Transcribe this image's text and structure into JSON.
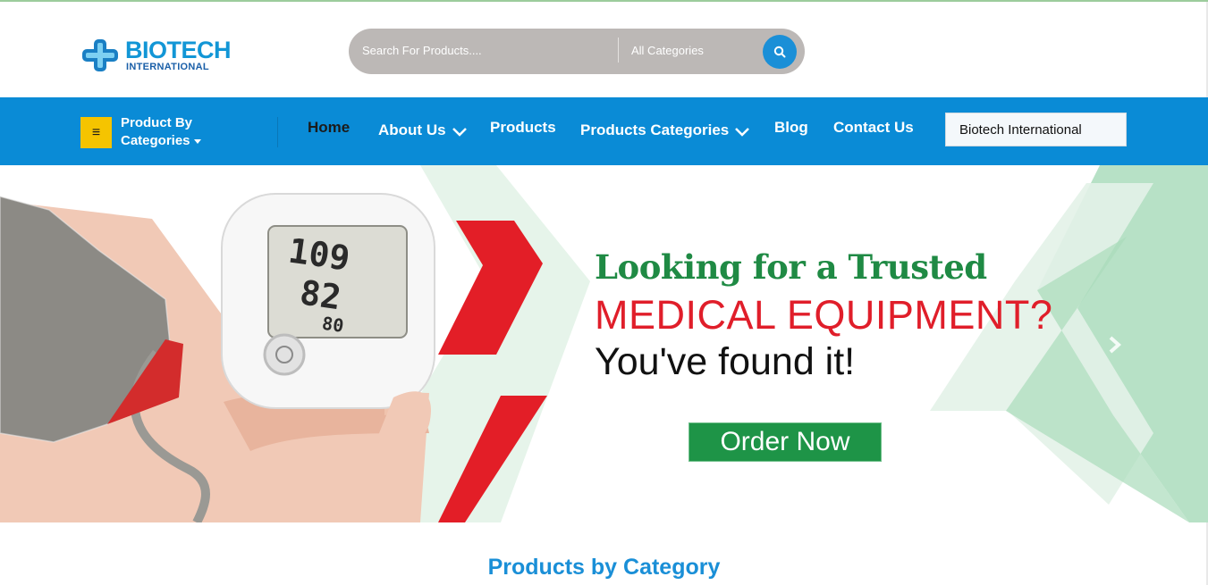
{
  "brand": {
    "name_line1": "BIOTECH",
    "name_line2": "INTERNATIONAL",
    "primary_color": "#1296d6"
  },
  "search": {
    "placeholder": "Search For Products....",
    "category_value": "All Categories",
    "button_icon": "search-icon"
  },
  "nav": {
    "background": "#0a8bd6",
    "category_menu": {
      "label_line1": "Product By",
      "label_line2": "Categories",
      "icon": "hamburger-icon"
    },
    "items": [
      {
        "label": "Home",
        "active": true
      },
      {
        "label": "About Us",
        "dropdown": true
      },
      {
        "label": "Products"
      },
      {
        "label": "Products Categories",
        "dropdown": true
      },
      {
        "label": "Blog"
      },
      {
        "label": "Contact Us"
      }
    ],
    "select_value": "Biotech International"
  },
  "banner": {
    "headline": "Looking for a Trusted",
    "subheadline": "MEDICAL EQUIPMENT?",
    "tagline": "You've found it!",
    "cta": "Order Now",
    "device_readings": {
      "sys": "109",
      "dia": "82",
      "pulse": "80"
    },
    "next_icon": "chevron-right-icon"
  },
  "section": {
    "title": "Products by Category"
  }
}
